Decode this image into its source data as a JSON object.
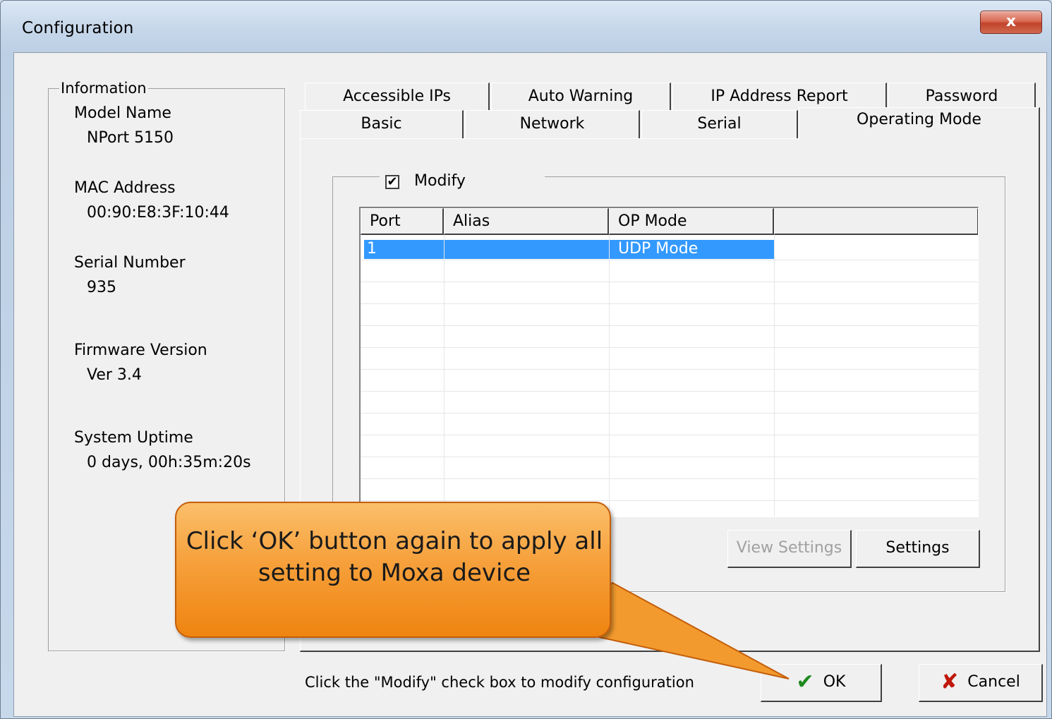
{
  "window": {
    "title": "Configuration",
    "close_label": "x"
  },
  "info": {
    "legend": "Information",
    "fields": [
      {
        "label": "Model Name",
        "value": "NPort 5150"
      },
      {
        "label": "MAC Address",
        "value": "00:90:E8:3F:10:44"
      },
      {
        "label": "Serial Number",
        "value": "935"
      },
      {
        "label": "Firmware Version",
        "value": "Ver 3.4"
      },
      {
        "label": "System Uptime",
        "value": "0 days, 00h:35m:20s"
      }
    ]
  },
  "tabs": {
    "row1": [
      "Accessible IPs",
      "Auto Warning",
      "IP Address Report",
      "Password"
    ],
    "row2": [
      "Basic",
      "Network",
      "Serial",
      "Operating Mode"
    ],
    "active": "Operating Mode"
  },
  "modify": {
    "label": "Modify",
    "checked": true,
    "check_glyph": "✔"
  },
  "table": {
    "columns": [
      "Port",
      "Alias",
      "OP Mode"
    ],
    "rows": [
      {
        "port": "1",
        "alias": "",
        "op_mode": "UDP Mode"
      }
    ]
  },
  "buttons": {
    "view_settings": "View Settings",
    "settings": "Settings",
    "ok": "OK",
    "cancel": "Cancel"
  },
  "status": {
    "hint": "Click the \"Modify\" check box to modify configuration"
  },
  "callout": {
    "text": "Click ‘OK’ button again to apply all setting to Moxa device"
  },
  "colors": {
    "selection": "#3399ff",
    "ok_check": "#1f8a1f",
    "cancel_x": "#c0180c",
    "callout": "#f6a03b"
  }
}
